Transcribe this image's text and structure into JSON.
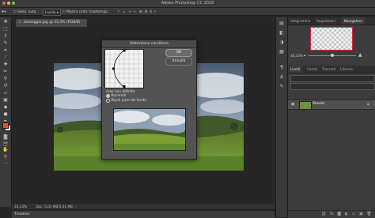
{
  "window": {
    "title": "Adobe Photoshop CC 2018"
  },
  "options_bar": {
    "select_label": "Selez. auto.",
    "select_value": "Livello",
    "transform_label": "Mostra contr. trasformaz."
  },
  "document": {
    "tab_title": "zoesoggio.jpg @ 33,3% (RGB/8)",
    "close_glyph": "×",
    "zoom": "33,33%",
    "doc_info": "Doc: 5,01 MB/5,01 MB"
  },
  "timeline": {
    "label": "Timeline"
  },
  "dialog": {
    "title": "Distorsione curvilinea",
    "ok_label": "OK",
    "cancel_label": "Annulla",
    "undefined_areas_label": "Aree non definite:",
    "option_repeat": "Ripremdi",
    "option_repeat_selected": true,
    "option_edge": "Ripeti pixel del bordo"
  },
  "panels": {
    "top_tabs": [
      "Istogramma",
      "Regolazioni",
      "Navigatore"
    ],
    "top_active": "Navigatore",
    "navigator_zoom": "33,33%",
    "layer_tabs": [
      "Livelli",
      "Canali",
      "Tracciati",
      "Librerie"
    ],
    "layer_active": "Livelli",
    "layer_name": "Shores"
  },
  "colors": {
    "foreground": "#e2581b",
    "background": "#ffffff",
    "navigator_highlight": "#d9243a"
  },
  "icons": {
    "tools": [
      "move-tool-icon",
      "marquee-tool-icon",
      "lasso-tool-icon",
      "quick-select-tool-icon",
      "crop-tool-icon",
      "eyedropper-tool-icon",
      "healing-brush-tool-icon",
      "brush-tool-icon",
      "stamp-tool-icon",
      "history-brush-tool-icon",
      "eraser-tool-icon",
      "gradient-tool-icon",
      "blur-tool-icon",
      "dodge-tool-icon",
      "pen-tool-icon",
      "type-tool-icon",
      "path-select-tool-icon",
      "shape-tool-icon",
      "hand-tool-icon",
      "zoom-tool-icon",
      "more-tools-icon"
    ]
  }
}
